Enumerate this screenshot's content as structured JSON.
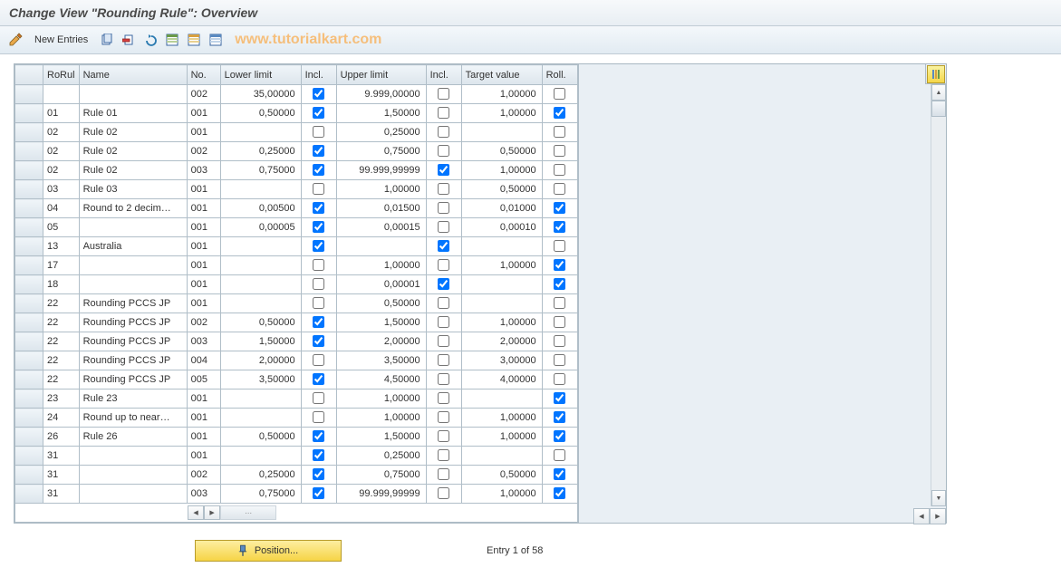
{
  "header": {
    "title": "Change View \"Rounding Rule\": Overview"
  },
  "toolbar": {
    "new_entries": "New Entries"
  },
  "watermark": "www.tutorialkart.com",
  "table": {
    "headers": {
      "rorul": "RoRul",
      "name": "Name",
      "no": "No.",
      "lower": "Lower limit",
      "incl1": "Incl.",
      "upper": "Upper limit",
      "incl2": "Incl.",
      "target": "Target value",
      "roll": "Roll."
    },
    "rows": [
      {
        "rorul": "",
        "name": "",
        "no": "002",
        "lower": "35,00000",
        "incl1": true,
        "upper": "9.999,00000",
        "incl2": false,
        "target": "1,00000",
        "roll": false
      },
      {
        "rorul": "01",
        "name": "Rule 01",
        "no": "001",
        "lower": "0,50000",
        "incl1": true,
        "upper": "1,50000",
        "incl2": false,
        "target": "1,00000",
        "roll": true
      },
      {
        "rorul": "02",
        "name": "Rule 02",
        "no": "001",
        "lower": "",
        "incl1": false,
        "upper": "0,25000",
        "incl2": false,
        "target": "",
        "roll": false
      },
      {
        "rorul": "02",
        "name": "Rule 02",
        "no": "002",
        "lower": "0,25000",
        "incl1": true,
        "upper": "0,75000",
        "incl2": false,
        "target": "0,50000",
        "roll": false
      },
      {
        "rorul": "02",
        "name": "Rule 02",
        "no": "003",
        "lower": "0,75000",
        "incl1": true,
        "upper": "99.999,99999",
        "incl2": true,
        "target": "1,00000",
        "roll": false
      },
      {
        "rorul": "03",
        "name": "Rule 03",
        "no": "001",
        "lower": "",
        "incl1": false,
        "upper": "1,00000",
        "incl2": false,
        "target": "0,50000",
        "roll": false
      },
      {
        "rorul": "04",
        "name": "Round to 2 decim…",
        "no": "001",
        "lower": "0,00500",
        "incl1": true,
        "upper": "0,01500",
        "incl2": false,
        "target": "0,01000",
        "roll": true
      },
      {
        "rorul": "05",
        "name": "",
        "no": "001",
        "lower": "0,00005",
        "incl1": true,
        "upper": "0,00015",
        "incl2": false,
        "target": "0,00010",
        "roll": true
      },
      {
        "rorul": "13",
        "name": "Australia",
        "no": "001",
        "lower": "",
        "incl1": true,
        "upper": "",
        "incl2": true,
        "target": "",
        "roll": false
      },
      {
        "rorul": "17",
        "name": "",
        "no": "001",
        "lower": "",
        "incl1": false,
        "upper": "1,00000",
        "incl2": false,
        "target": "1,00000",
        "roll": true
      },
      {
        "rorul": "18",
        "name": "",
        "no": "001",
        "lower": "",
        "incl1": false,
        "upper": "0,00001",
        "incl2": true,
        "target": "",
        "roll": true
      },
      {
        "rorul": "22",
        "name": "Rounding PCCS JP",
        "no": "001",
        "lower": "",
        "incl1": false,
        "upper": "0,50000",
        "incl2": false,
        "target": "",
        "roll": false
      },
      {
        "rorul": "22",
        "name": "Rounding PCCS JP",
        "no": "002",
        "lower": "0,50000",
        "incl1": true,
        "upper": "1,50000",
        "incl2": false,
        "target": "1,00000",
        "roll": false
      },
      {
        "rorul": "22",
        "name": "Rounding PCCS JP",
        "no": "003",
        "lower": "1,50000",
        "incl1": true,
        "upper": "2,00000",
        "incl2": false,
        "target": "2,00000",
        "roll": false
      },
      {
        "rorul": "22",
        "name": "Rounding PCCS JP",
        "no": "004",
        "lower": "2,00000",
        "incl1": false,
        "upper": "3,50000",
        "incl2": false,
        "target": "3,00000",
        "roll": false
      },
      {
        "rorul": "22",
        "name": "Rounding PCCS JP",
        "no": "005",
        "lower": "3,50000",
        "incl1": true,
        "upper": "4,50000",
        "incl2": false,
        "target": "4,00000",
        "roll": false
      },
      {
        "rorul": "23",
        "name": "Rule 23",
        "no": "001",
        "lower": "",
        "incl1": false,
        "upper": "1,00000",
        "incl2": false,
        "target": "",
        "roll": true
      },
      {
        "rorul": "24",
        "name": "Round up to near…",
        "no": "001",
        "lower": "",
        "incl1": false,
        "upper": "1,00000",
        "incl2": false,
        "target": "1,00000",
        "roll": true
      },
      {
        "rorul": "26",
        "name": "Rule 26",
        "no": "001",
        "lower": "0,50000",
        "incl1": true,
        "upper": "1,50000",
        "incl2": false,
        "target": "1,00000",
        "roll": true
      },
      {
        "rorul": "31",
        "name": "",
        "no": "001",
        "lower": "",
        "incl1": true,
        "upper": "0,25000",
        "incl2": false,
        "target": "",
        "roll": false
      },
      {
        "rorul": "31",
        "name": "",
        "no": "002",
        "lower": "0,25000",
        "incl1": true,
        "upper": "0,75000",
        "incl2": false,
        "target": "0,50000",
        "roll": true
      },
      {
        "rorul": "31",
        "name": "",
        "no": "003",
        "lower": "0,75000",
        "incl1": true,
        "upper": "99.999,99999",
        "incl2": false,
        "target": "1,00000",
        "roll": true
      }
    ]
  },
  "footer": {
    "position_label": "Position...",
    "entry_info": "Entry 1 of 58"
  }
}
